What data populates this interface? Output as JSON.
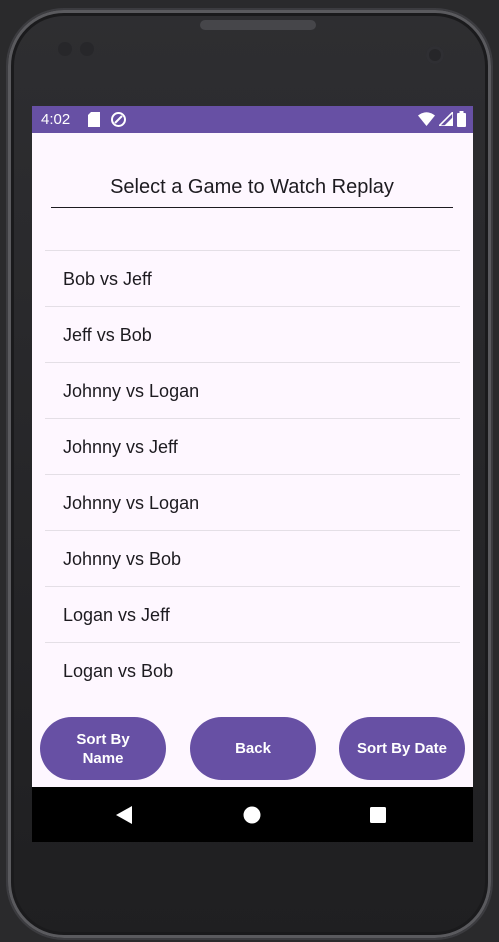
{
  "status_bar": {
    "time": "4:02",
    "background": "#6750a4"
  },
  "header": {
    "title": "Select a Game to Watch Replay"
  },
  "games": [
    "Bob vs Jeff",
    "Jeff vs Bob",
    "Johnny vs Logan",
    "Johnny vs Jeff",
    "Johnny vs Logan",
    "Johnny vs Bob",
    "Logan vs Jeff",
    "Logan vs Bob"
  ],
  "buttons": {
    "sort_by_name": "Sort By Name",
    "back": "Back",
    "sort_by_date": "Sort By Date",
    "color": "#6750a4"
  },
  "nav": {
    "icons": [
      "back-triangle-icon",
      "home-circle-icon",
      "recents-square-icon"
    ]
  }
}
